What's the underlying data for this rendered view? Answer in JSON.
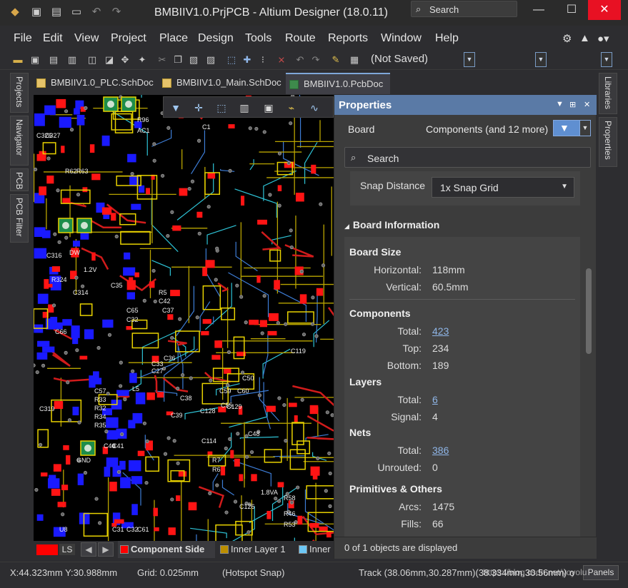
{
  "window": {
    "title": "BMBIIV1.0.PrjPCB - Altium Designer (18.0.11)",
    "search_placeholder": "Search",
    "min": "—",
    "max": "☐",
    "close": "✕"
  },
  "menu": {
    "items": [
      "File",
      "Edit",
      "View",
      "Project",
      "Place",
      "Design",
      "Tools",
      "Route",
      "Reports",
      "Window",
      "Help"
    ]
  },
  "toolbar": {
    "save_state": "(Not Saved)"
  },
  "left_tabs": [
    "Projects",
    "Navigator",
    "PCB",
    "PCB Filter"
  ],
  "right_tabs": [
    "Libraries",
    "Properties"
  ],
  "doc_tabs": [
    {
      "label": "BMBIIV1.0_PLC.SchDoc",
      "active": false
    },
    {
      "label": "BMBIIV1.0_Main.SchDoc",
      "active": false
    },
    {
      "label": "BMBIIV1.0.PcbDoc",
      "active": true
    }
  ],
  "layer_bar": {
    "current_label": "LS",
    "tabs": [
      {
        "label": "Component Side",
        "color": "#ff0000",
        "active": true
      },
      {
        "label": "Inner Layer 1",
        "color": "#bc8e00",
        "active": false
      },
      {
        "label": "Inner",
        "color": "#6cc7f5",
        "active": false
      }
    ]
  },
  "properties": {
    "title": "Properties",
    "scope": "Board",
    "components_filter": "Components (and 12 more)",
    "search_placeholder": "Search",
    "snap_distance_label": "Snap Distance",
    "snap_distance_value": "1x Snap Grid",
    "board_info_title": "Board Information",
    "board_size": {
      "title": "Board Size",
      "horizontal_label": "Horizontal:",
      "horizontal_value": "118mm",
      "vertical_label": "Vertical:",
      "vertical_value": "60.5mm"
    },
    "components": {
      "title": "Components",
      "total_label": "Total:",
      "total_value": "423",
      "top_label": "Top:",
      "top_value": "234",
      "bottom_label": "Bottom:",
      "bottom_value": "189"
    },
    "layers": {
      "title": "Layers",
      "total_label": "Total:",
      "total_value": "6",
      "signal_label": "Signal:",
      "signal_value": "4"
    },
    "nets": {
      "title": "Nets",
      "total_label": "Total:",
      "total_value": "386",
      "unrouted_label": "Unrouted:",
      "unrouted_value": "0"
    },
    "primitives": {
      "title": "Primitives & Others",
      "arcs_label": "Arcs:",
      "arcs_value": "1475",
      "fills_label": "Fills:",
      "fills_value": "66"
    },
    "status": "0 of 1 objects are displayed"
  },
  "status_bar": {
    "coords": "X:44.323mm Y:30.988mm",
    "grid": "Grid: 0.025mm",
    "snap": "(Hotspot Snap)",
    "track": "Track (38.06mm,30.287mm)(38.334mm,30.56mm) o",
    "panels": "Panels"
  },
  "watermark": "https://blog.csdn.net/yoyolu",
  "pcb_labels": [
    "R96",
    "AC1",
    "C1",
    "C326",
    "C327",
    "R62",
    "R63",
    "DW",
    "1.2V",
    "R324",
    "C314",
    "C316",
    "C35",
    "C65",
    "C32",
    "R5",
    "C42",
    "C37",
    "C33",
    "C27",
    "C66",
    "C36",
    "R33",
    "R32",
    "R34",
    "R35",
    "C40",
    "C41",
    "L5",
    "C57",
    "GND",
    "C319",
    "C59",
    "C60",
    "C38",
    "C128",
    "C55",
    "C50",
    "C48",
    "R7",
    "R6",
    "C114",
    "C39",
    "R58",
    "R46",
    "R53",
    "C126",
    "1.8VA",
    "C119",
    "U8",
    "C31",
    "C32",
    "C61",
    "C129",
    "LS"
  ],
  "colors": {
    "accent": "#5a7aa6",
    "filter_button": "#5f8fd1",
    "link": "#8fb6e8",
    "close_button": "#e81123"
  }
}
